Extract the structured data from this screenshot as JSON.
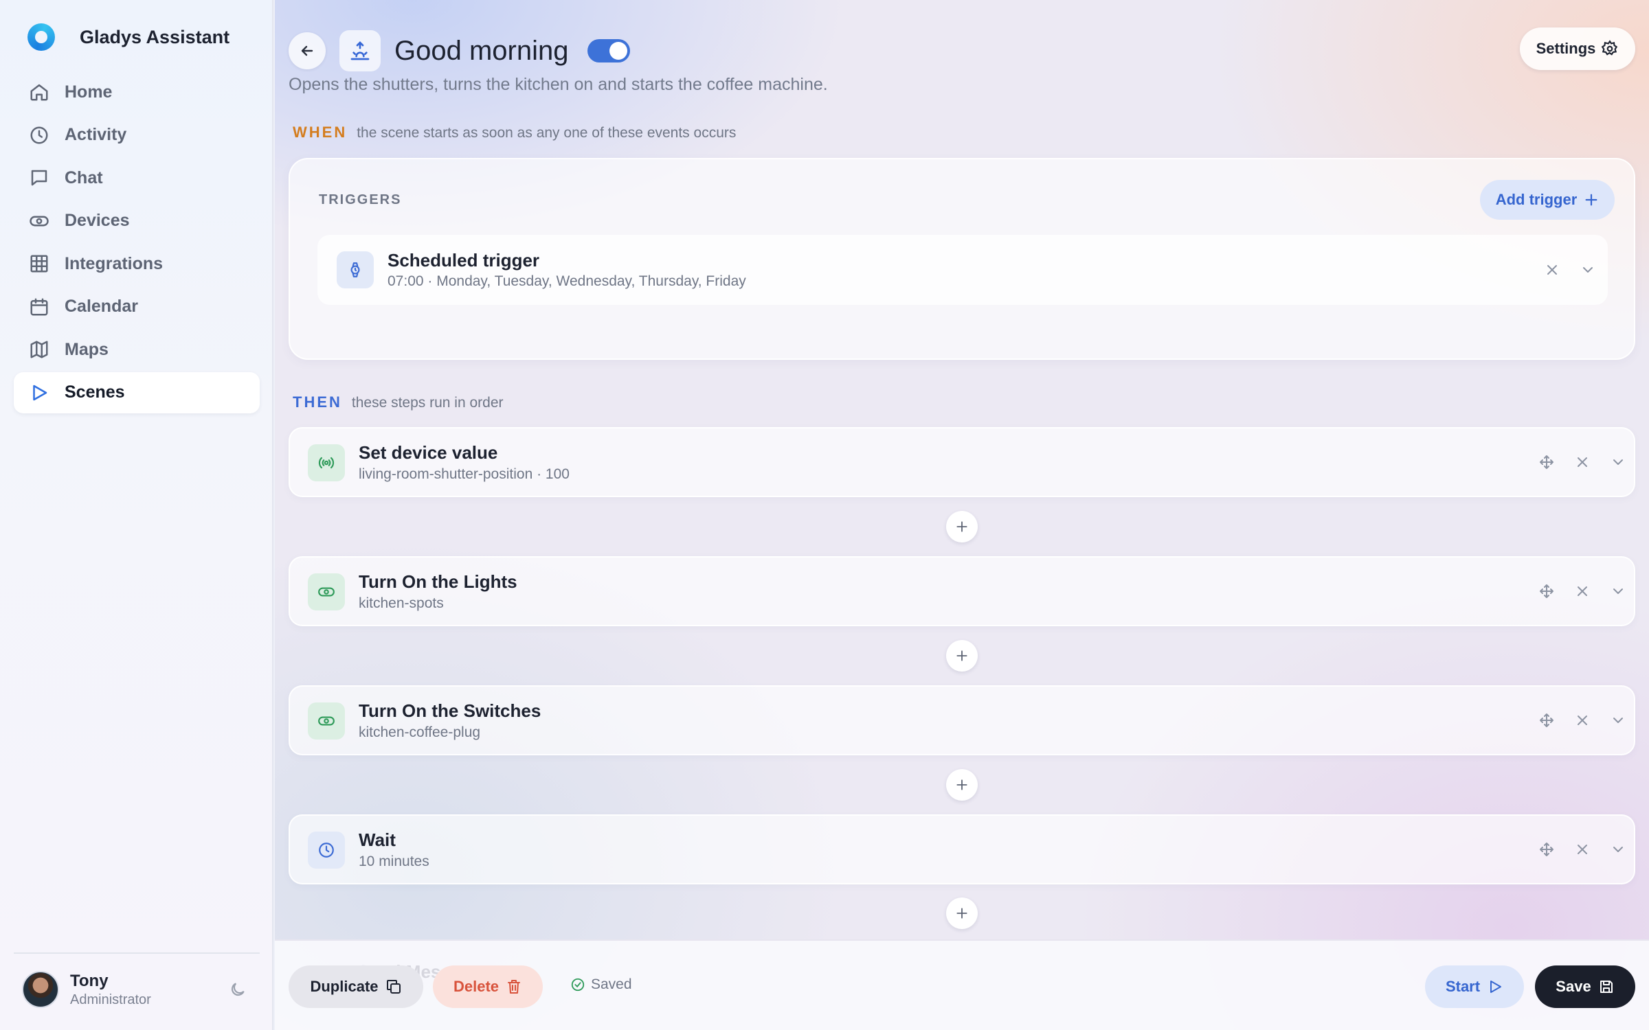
{
  "app": {
    "name": "Gladys Assistant"
  },
  "sidebar": {
    "items": [
      {
        "label": "Home",
        "icon": "home-icon",
        "active": false
      },
      {
        "label": "Activity",
        "icon": "clock-icon",
        "active": false
      },
      {
        "label": "Chat",
        "icon": "message-icon",
        "active": false
      },
      {
        "label": "Devices",
        "icon": "toggle-icon",
        "active": false
      },
      {
        "label": "Integrations",
        "icon": "grid-icon",
        "active": false
      },
      {
        "label": "Calendar",
        "icon": "calendar-icon",
        "active": false
      },
      {
        "label": "Maps",
        "icon": "map-icon",
        "active": false
      },
      {
        "label": "Scenes",
        "icon": "play-icon",
        "active": true
      }
    ]
  },
  "user": {
    "name": "Tony",
    "role": "Administrator"
  },
  "scene": {
    "title": "Good morning",
    "enabled": true,
    "description": "Opens the shutters, turns the kitchen on and starts the coffee machine."
  },
  "header": {
    "settings_label": "Settings"
  },
  "when": {
    "keyword": "WHEN",
    "description": "the scene starts as soon as any one of these events occurs",
    "triggers_label": "TRIGGERS",
    "add_trigger_label": "Add trigger",
    "trigger": {
      "title": "Scheduled trigger",
      "subtitle": "07:00 · Monday, Tuesday, Wednesday, Thursday, Friday"
    }
  },
  "then": {
    "keyword": "THEN",
    "description": "these steps run in order",
    "steps": [
      {
        "title": "Set device value",
        "subtitle": "living-room-shutter-position · 100",
        "icon": "broadcast-icon"
      },
      {
        "title": "Turn On the Lights",
        "subtitle": "kitchen-spots",
        "icon": "toggle-icon"
      },
      {
        "title": "Turn On the Switches",
        "subtitle": "kitchen-coffee-plug",
        "icon": "toggle-icon"
      },
      {
        "title": "Wait",
        "subtitle": "10 minutes",
        "icon": "clock-icon"
      }
    ],
    "partial_step_title": "Send Mes"
  },
  "footer": {
    "duplicate_label": "Duplicate",
    "delete_label": "Delete",
    "saved_label": "Saved",
    "start_label": "Start",
    "save_label": "Save"
  },
  "colors": {
    "accent": "#3d72d8",
    "when_key": "#d47d1f",
    "then_key": "#3c6bd4",
    "delete": "#d8533c",
    "success": "#2f9b5a"
  }
}
